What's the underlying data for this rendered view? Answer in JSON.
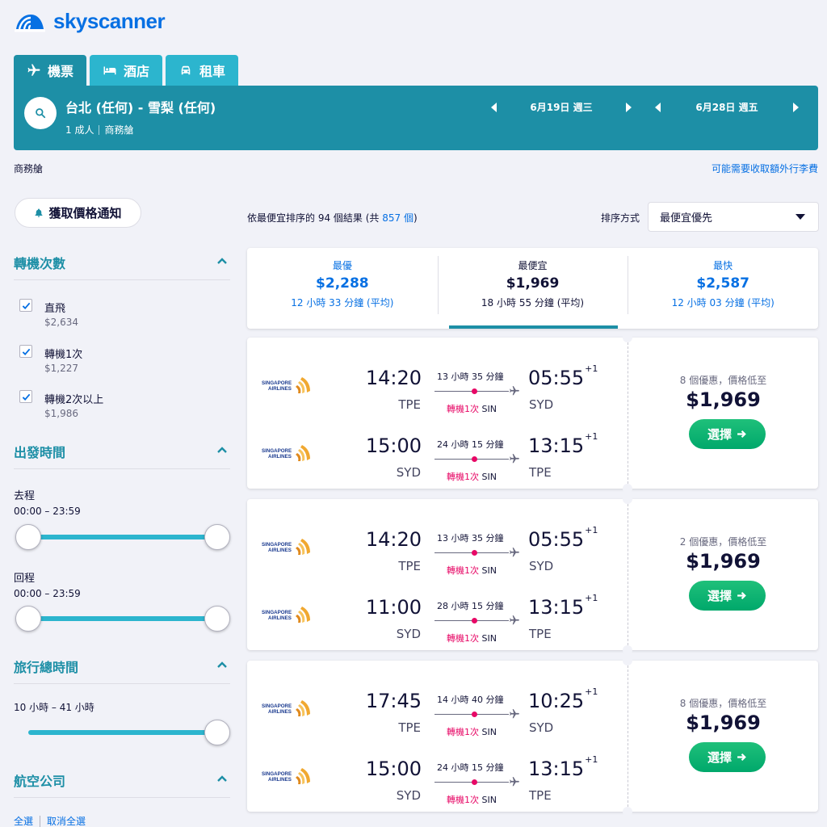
{
  "brand": {
    "name": "skyscanner",
    "color": "#0770e3"
  },
  "tabs": [
    {
      "label": "機票",
      "icon": "plane-icon"
    },
    {
      "label": "酒店",
      "icon": "bed-icon"
    },
    {
      "label": "租車",
      "icon": "car-icon"
    }
  ],
  "search": {
    "route": "台北 (任何) - 雪梨 (任何)",
    "passengers": "1 成人",
    "cabin": "商務艙",
    "depart_date": "6月19日 週三",
    "return_date": "6月28日 週五"
  },
  "cabin_note": "商務艙",
  "baggage_link": "可能需要收取額外行李費",
  "sidebar": {
    "price_alert": "獲取價格通知",
    "stops": {
      "title": "轉機次數",
      "options": [
        {
          "label": "直飛",
          "price": "$2,634",
          "checked": true
        },
        {
          "label": "轉機1次",
          "price": "$1,227",
          "checked": true
        },
        {
          "label": "轉機2次以上",
          "price": "$1,986",
          "checked": true
        }
      ]
    },
    "departure_times": {
      "title": "出發時間",
      "outbound_label": "去程",
      "outbound_range": "00:00 – 23:59",
      "return_label": "回程",
      "return_range": "00:00 – 23:59"
    },
    "journey_duration": {
      "title": "旅行總時間",
      "range": "10 小時 – 41 小時"
    },
    "airlines": {
      "title": "航空公司",
      "select_all": "全選",
      "clear_all": "取消全選"
    }
  },
  "results": {
    "count_prefix": "依最便宜排序的 94 個結果 (共",
    "count_total": "857 個",
    "count_suffix": ")",
    "sort_label": "排序方式",
    "sort_value": "最便宜優先"
  },
  "summary": [
    {
      "label": "最優",
      "price": "$2,288",
      "duration": "12 小時 33 分鐘 (平均)",
      "active": false
    },
    {
      "label": "最便宜",
      "price": "$1,969",
      "duration": "18 小時 55 分鐘 (平均)",
      "active": true
    },
    {
      "label": "最快",
      "price": "$2,587",
      "duration": "12 小時 03 分鐘 (平均)",
      "active": false
    }
  ],
  "itineraries": [
    {
      "deals": "8 個優惠，價格低至",
      "price": "$1,969",
      "select_label": "選擇",
      "legs": [
        {
          "airline": "SINGAPORE AIRLINES",
          "dep_time": "14:20",
          "dep_code": "TPE",
          "duration": "13 小時 35 分鐘",
          "stops": "轉機1次",
          "via": "SIN",
          "arr_time": "05:55",
          "day_offset": "+1",
          "arr_code": "SYD"
        },
        {
          "airline": "SINGAPORE AIRLINES",
          "dep_time": "15:00",
          "dep_code": "SYD",
          "duration": "24 小時 15 分鐘",
          "stops": "轉機1次",
          "via": "SIN",
          "arr_time": "13:15",
          "day_offset": "+1",
          "arr_code": "TPE"
        }
      ]
    },
    {
      "deals": "2 個優惠，價格低至",
      "price": "$1,969",
      "select_label": "選擇",
      "legs": [
        {
          "airline": "SINGAPORE AIRLINES",
          "dep_time": "14:20",
          "dep_code": "TPE",
          "duration": "13 小時 35 分鐘",
          "stops": "轉機1次",
          "via": "SIN",
          "arr_time": "05:55",
          "day_offset": "+1",
          "arr_code": "SYD"
        },
        {
          "airline": "SINGAPORE AIRLINES",
          "dep_time": "11:00",
          "dep_code": "SYD",
          "duration": "28 小時 15 分鐘",
          "stops": "轉機1次",
          "via": "SIN",
          "arr_time": "13:15",
          "day_offset": "+1",
          "arr_code": "TPE"
        }
      ]
    },
    {
      "deals": "8 個優惠，價格低至",
      "price": "$1,969",
      "select_label": "選擇",
      "legs": [
        {
          "airline": "SINGAPORE AIRLINES",
          "dep_time": "17:45",
          "dep_code": "TPE",
          "duration": "14 小時 40 分鐘",
          "stops": "轉機1次",
          "via": "SIN",
          "arr_time": "10:25",
          "day_offset": "+1",
          "arr_code": "SYD"
        },
        {
          "airline": "SINGAPORE AIRLINES",
          "dep_time": "15:00",
          "dep_code": "SYD",
          "duration": "24 小時 15 分鐘",
          "stops": "轉機1次",
          "via": "SIN",
          "arr_time": "13:15",
          "day_offset": "+1",
          "arr_code": "TPE"
        }
      ]
    }
  ],
  "colors": {
    "teal_dark": "#1d8fa6",
    "teal": "#2cb5ce",
    "link": "#0770e3",
    "stop_red": "#e70866",
    "select_green": "#00a86b"
  }
}
